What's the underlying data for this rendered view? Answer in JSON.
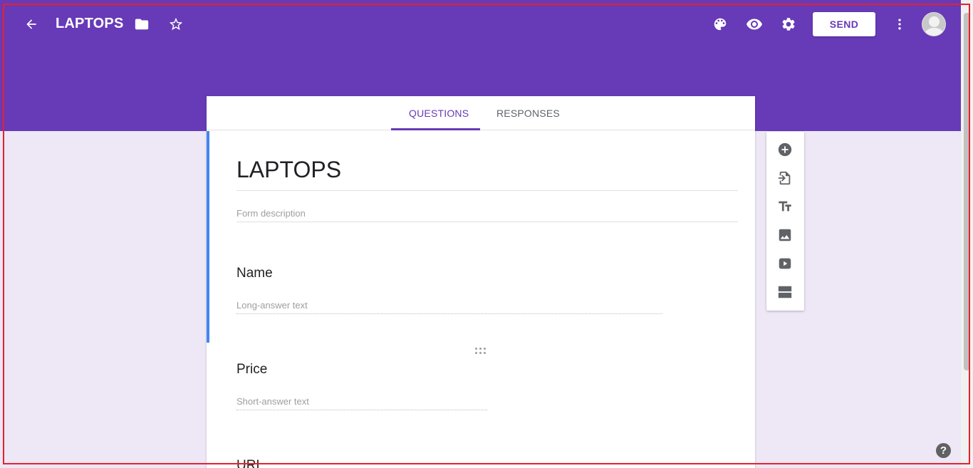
{
  "header": {
    "title": "LAPTOPS",
    "send_label": "SEND",
    "color": "#673ab7",
    "icons": [
      "arrow-back-icon",
      "folder-icon",
      "star-outline-icon",
      "palette-icon",
      "preview-eye-icon",
      "settings-gear-icon",
      "more-vert-icon"
    ]
  },
  "tabs": [
    {
      "label": "QUESTIONS",
      "active": true
    },
    {
      "label": "RESPONSES",
      "active": false
    }
  ],
  "form": {
    "title": "LAPTOPS",
    "description_placeholder": "Form description"
  },
  "questions": [
    {
      "title": "Name",
      "hint": "Long-answer text"
    },
    {
      "title": "Price",
      "hint": "Short-answer text"
    },
    {
      "title": "URL",
      "hint": ""
    }
  ],
  "toolbar": {
    "items": [
      "add-question-icon",
      "import-questions-icon",
      "add-title-icon",
      "add-image-icon",
      "add-video-icon",
      "add-section-icon"
    ]
  },
  "help_label": "?",
  "colors": {
    "accent": "#673ab7",
    "background": "#ede7f6",
    "focus_bar": "#4285f4"
  }
}
